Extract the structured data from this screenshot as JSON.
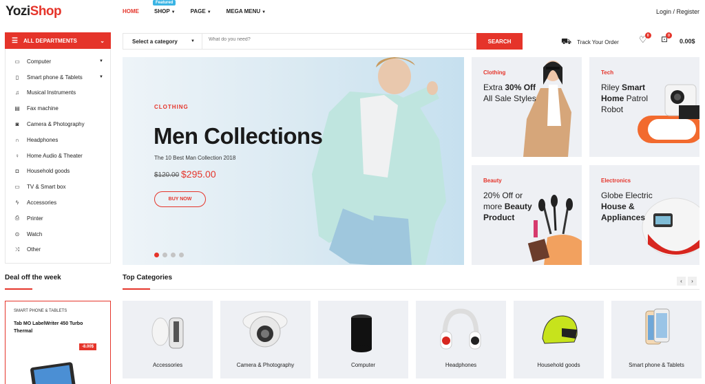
{
  "logo": {
    "part1": "Yozi",
    "part2": "Shop"
  },
  "nav": {
    "items": [
      {
        "label": "HOME",
        "active": true,
        "caret": false
      },
      {
        "label": "SHOP",
        "active": false,
        "caret": true
      },
      {
        "label": "PAGE",
        "active": false,
        "caret": true
      },
      {
        "label": "MEGA MENU",
        "active": false,
        "caret": true
      }
    ],
    "featured_badge": "Featured"
  },
  "account": {
    "login_label": "Login / Register"
  },
  "departments": {
    "header": "ALL DEPARTMENTS",
    "items": [
      {
        "label": "Computer",
        "icon": "laptop-icon",
        "submenu": true
      },
      {
        "label": "Smart phone & Tablets",
        "icon": "phone-icon",
        "submenu": true
      },
      {
        "label": "Musical Instruments",
        "icon": "music-icon",
        "submenu": false
      },
      {
        "label": "Fax machine",
        "icon": "fax-icon",
        "submenu": false
      },
      {
        "label": "Camera & Photography",
        "icon": "camera-icon",
        "submenu": false
      },
      {
        "label": "Headphones",
        "icon": "headphones-icon",
        "submenu": false
      },
      {
        "label": "Home Audio & Theater",
        "icon": "microphone-icon",
        "submenu": false
      },
      {
        "label": "Household goods",
        "icon": "bag-icon",
        "submenu": false
      },
      {
        "label": "TV & Smart box",
        "icon": "tv-icon",
        "submenu": false
      },
      {
        "label": "Accessories",
        "icon": "bolt-icon",
        "submenu": false
      },
      {
        "label": "Printer",
        "icon": "printer-icon",
        "submenu": false
      },
      {
        "label": "Watch",
        "icon": "watch-icon",
        "submenu": false
      },
      {
        "label": "Other",
        "icon": "shuffle-icon",
        "submenu": false
      }
    ]
  },
  "search": {
    "category_label": "Select a category",
    "placeholder": "What do you need?",
    "button_label": "SEARCH"
  },
  "header_tools": {
    "track_label": "Track Your Order",
    "wishlist_count": "0",
    "cart_count": "0",
    "cart_total": "0.00$"
  },
  "hero": {
    "tag": "CLOTHING",
    "title": "Men Collections",
    "subtitle": "The 10 Best Man Collection 2018",
    "old_price": "$120.00",
    "new_price": "$295.00",
    "button": "BUY NOW",
    "slides": 4,
    "active_slide": 1
  },
  "promos": [
    {
      "tag": "Clothing",
      "pre": "Extra ",
      "bold": "30% Off",
      "post": " All Sale Styles"
    },
    {
      "tag": "Tech",
      "pre": "Riley ",
      "bold": "Smart Home",
      "post": " Patrol Robot"
    },
    {
      "tag": "Beauty",
      "pre": "20% Off or more ",
      "bold": "Beauty Product",
      "post": ""
    },
    {
      "tag": "Electronics",
      "pre": "Globe Electric ",
      "bold": "House & Appliances",
      "post": ""
    }
  ],
  "deal": {
    "heading": "Deal off the week",
    "category": "SMART PHONE & TABLETS",
    "name": "Tab MO LabelWriter 450 Turbo Thermal",
    "discount": "-8.00$"
  },
  "top_categories": {
    "heading": "Top Categories",
    "prev": "‹",
    "next": "›",
    "items": [
      {
        "label": "Accessories"
      },
      {
        "label": "Camera & Photography"
      },
      {
        "label": "Computer"
      },
      {
        "label": "Headphones"
      },
      {
        "label": "Household goods"
      },
      {
        "label": "Smart phone & Tablets"
      }
    ]
  },
  "colors": {
    "accent": "#e5342a",
    "badge": "#3ab4e4",
    "tile_bg": "#eef0f4"
  }
}
